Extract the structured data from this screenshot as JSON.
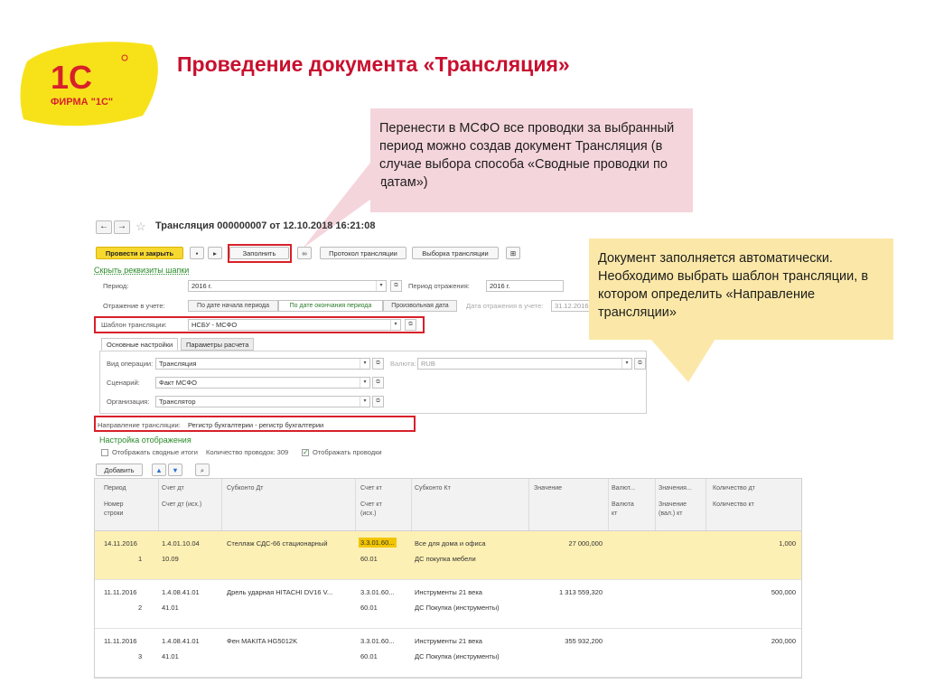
{
  "slide": {
    "logo_text": "1С",
    "logo_caption": "ФИРМА \"1С\"",
    "title": "Проведение документа «Трансляция»",
    "callout_pink": "Перенести в МСФО все проводки за выбранный период можно создав документ Трансляция (в случае выбора способа «Сводные проводки по датам»)",
    "callout_yellow": "Документ заполняется автоматически. Необходимо выбрать шаблон трансляции, в котором определить «Направление трансляции»"
  },
  "window": {
    "nav_back": "←",
    "nav_forward": "→",
    "star": "☆",
    "title": "Трансляция 000000007 от 12.10.2018 16:21:08",
    "toolbar": {
      "post_close": "Провести и закрыть",
      "fill": "Заполнить",
      "protocol": "Протокол трансляции",
      "selection": "Выборка трансляции"
    },
    "hide_header_link": "Скрыть реквизиты шапки",
    "period_label": "Период:",
    "period_value": "2016 г.",
    "reflection_period_label": "Период отражения:",
    "reflection_period_value": "2016 г.",
    "reflection_label": "Отражение в учете:",
    "seg_start": "По дате начала периода",
    "seg_end": "По дате окончания периода",
    "seg_custom": "Произвольная дата",
    "reflection_date_label": "Дата отражения в учете:",
    "reflection_date_value": "31.12.2016",
    "template_label": "Шаблон трансляции:",
    "template_value": "НСБУ - МСФО",
    "tab_main": "Основные настройки",
    "tab_calc": "Параметры расчета",
    "operation_label": "Вид операции:",
    "operation_value": "Трансляция",
    "currency_label": "Валюта:",
    "currency_value": "RUB",
    "scenario_label": "Сценарий:",
    "scenario_value": "Факт МСФО",
    "org_label": "Организация:",
    "org_value": "Транслятор",
    "direction_label": "Направление трансляции:",
    "direction_value": "Регистр бухгалтерии - регистр бухгалтерии",
    "display_settings_link": "Настройка отображения",
    "show_summary_label": "Отображать сводные итоги",
    "count_label": "Количество проводок: 309",
    "show_entries_label": "Отображать проводки",
    "add_button": "Добавить"
  },
  "table": {
    "headers": {
      "period": "Период",
      "row_no_1": "Номер",
      "row_no_2": "строки",
      "acc_dt": "Счет дт",
      "acc_dt_src": "Счет дт (исх.)",
      "sub_dt": "Субконто Дт",
      "acc_kt": "Счет кт",
      "acc_kt_src_1": "Счет кт",
      "acc_kt_src_2": "(исх.)",
      "sub_kt": "Субконто Кт",
      "value": "Значение",
      "curr_1": "Валют...",
      "curr_2a": "Валюта",
      "curr_2b": "кт",
      "val_curr_1": "Значения...",
      "val_curr_2a": "Значение",
      "val_curr_2b": "(вал.) кт",
      "qty_dt": "Количество дт",
      "qty_kt": "Количество кт"
    },
    "rows": [
      {
        "date": "14.11.2016",
        "num": "1",
        "acc_dt": "1.4.01.10.04",
        "acc_dt_src": "10.09",
        "sub_dt": "Стеллаж СДС-66 стационарный",
        "acc_kt": "3.3.01.60...",
        "acc_kt_src": "60.01",
        "sub_kt_1": "Все для дома и офиса",
        "sub_kt_2": "ДС покупка мебели",
        "value": "27 000,000",
        "qty": "1,000"
      },
      {
        "date": "11.11.2016",
        "num": "2",
        "acc_dt": "1.4.08.41.01",
        "acc_dt_src": "41.01",
        "sub_dt": "Дрель ударная HITACHI DV16 V...",
        "acc_kt": "3.3.01.60...",
        "acc_kt_src": "60.01",
        "sub_kt_1": "Инструменты 21 века",
        "sub_kt_2": "ДС Покупка (инструменты)",
        "value": "1 313 559,320",
        "qty": "500,000"
      },
      {
        "date": "11.11.2016",
        "num": "3",
        "acc_dt": "1.4.08.41.01",
        "acc_dt_src": "41.01",
        "sub_dt": "Фен MAKITA HG5012K",
        "acc_kt": "3.3.01.60...",
        "acc_kt_src": "60.01",
        "sub_kt_1": "Инструменты 21 века",
        "sub_kt_2": "ДС Покупка (инструменты)",
        "value": "355 932,200",
        "qty": "200,000"
      }
    ]
  },
  "colors": {
    "title_red": "#c8102e",
    "highlight_red": "#d8202a",
    "pink_callout": "#f5d5dc",
    "yellow_callout": "#fbe8a8",
    "primary_yellow": "#f7d830",
    "selected_row": "#fdf0b4"
  }
}
